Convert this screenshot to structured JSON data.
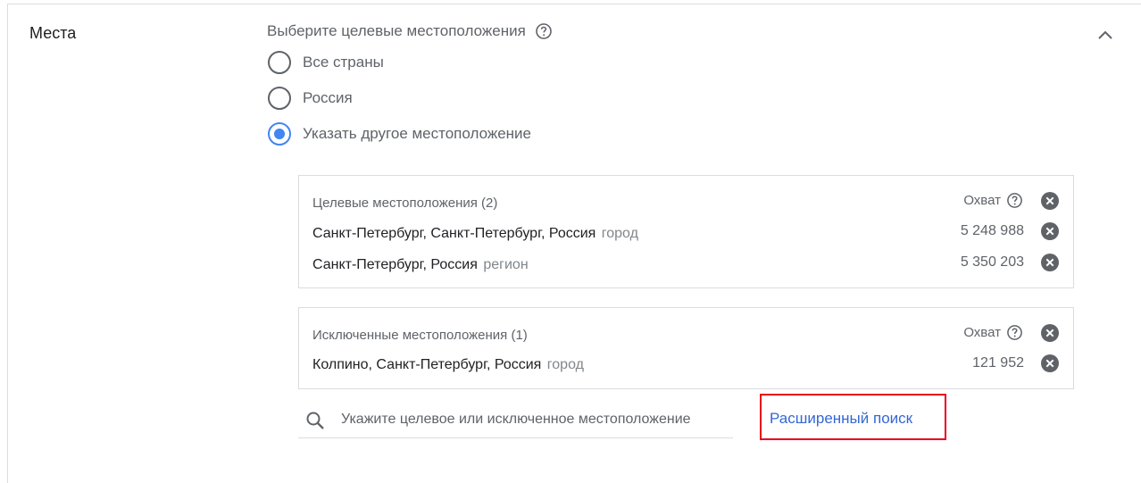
{
  "section": {
    "title": "Места"
  },
  "targeting": {
    "prompt": "Выберите целевые местоположения",
    "options": [
      {
        "label": "Все страны",
        "checked": false
      },
      {
        "label": "Россия",
        "checked": false
      },
      {
        "label": "Указать другое местоположение",
        "checked": true
      }
    ]
  },
  "targeted": {
    "header": "Целевые местоположения (2)",
    "reach_label": "Охват",
    "rows": [
      {
        "name": "Санкт-Петербург, Санкт-Петербург, Россия",
        "type": "город",
        "reach": "5 248 988"
      },
      {
        "name": "Санкт-Петербург, Россия",
        "type": "регион",
        "reach": "5 350 203"
      }
    ]
  },
  "excluded": {
    "header": "Исключенные местоположения (1)",
    "reach_label": "Охват",
    "rows": [
      {
        "name": "Колпино, Санкт-Петербург, Россия",
        "type": "город",
        "reach": "121 952"
      }
    ]
  },
  "search": {
    "placeholder": "Укажите целевое или исключенное местоположение",
    "value": ""
  },
  "advanced_search": {
    "label": "Расширенный поиск"
  },
  "colors": {
    "accent": "#4285f4",
    "link": "#3367d6",
    "highlight_border": "#e8001c",
    "icon_gray": "#5f6368"
  },
  "icons": {
    "help": "help-circle-icon",
    "remove": "close-circle-icon",
    "collapse": "chevron-up-icon",
    "search": "search-icon"
  }
}
